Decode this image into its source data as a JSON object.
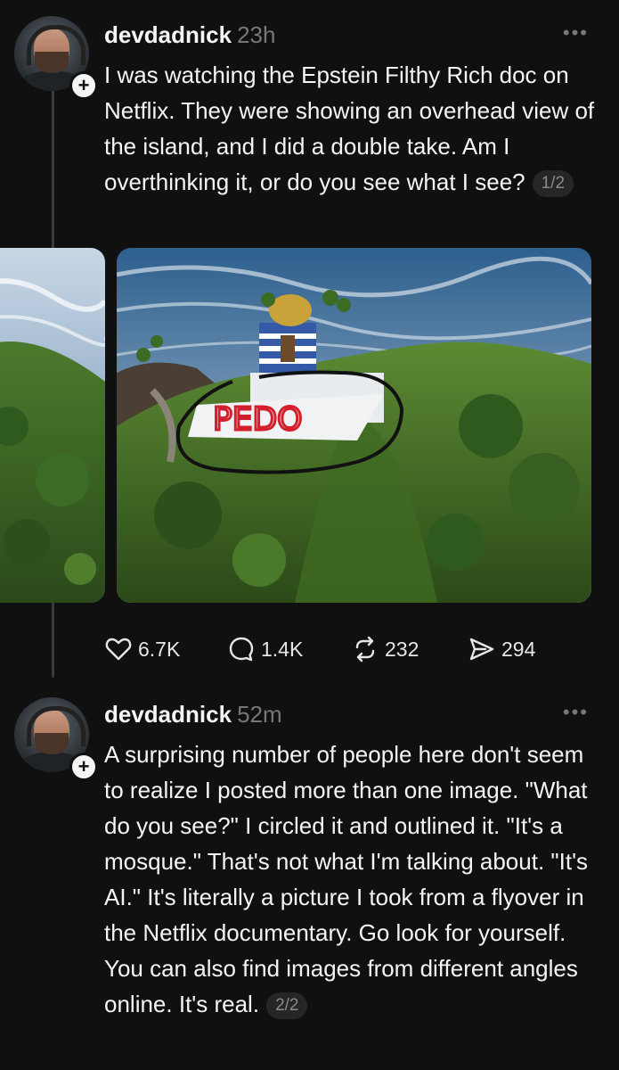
{
  "posts": [
    {
      "username": "devdadnick",
      "time": "23h",
      "text": "I was watching the Epstein Filthy Rich doc on Netflix. They were showing an overhead view of the island, and I did a double take. Am I overthinking it, or do you see what I see?",
      "counter": "1/2",
      "image_label": "PEDO",
      "actions": {
        "likes": "6.7K",
        "replies": "1.4K",
        "reposts": "232",
        "shares": "294"
      }
    },
    {
      "username": "devdadnick",
      "time": "52m",
      "text": "A surprising number of people here don't seem to realize I posted more than one image. \"What do you see?\" I circled it and outlined it. \"It's a mosque.\" That's not what I'm talking about. \"It's AI.\" It's literally a picture I took from a flyover in the Netflix documentary. Go look for yourself. You can also find images from different angles online. It's real.",
      "counter": "2/2"
    }
  ],
  "icons": [
    "more-icon",
    "plus-icon",
    "heart-icon",
    "reply-icon",
    "repost-icon",
    "share-icon"
  ]
}
